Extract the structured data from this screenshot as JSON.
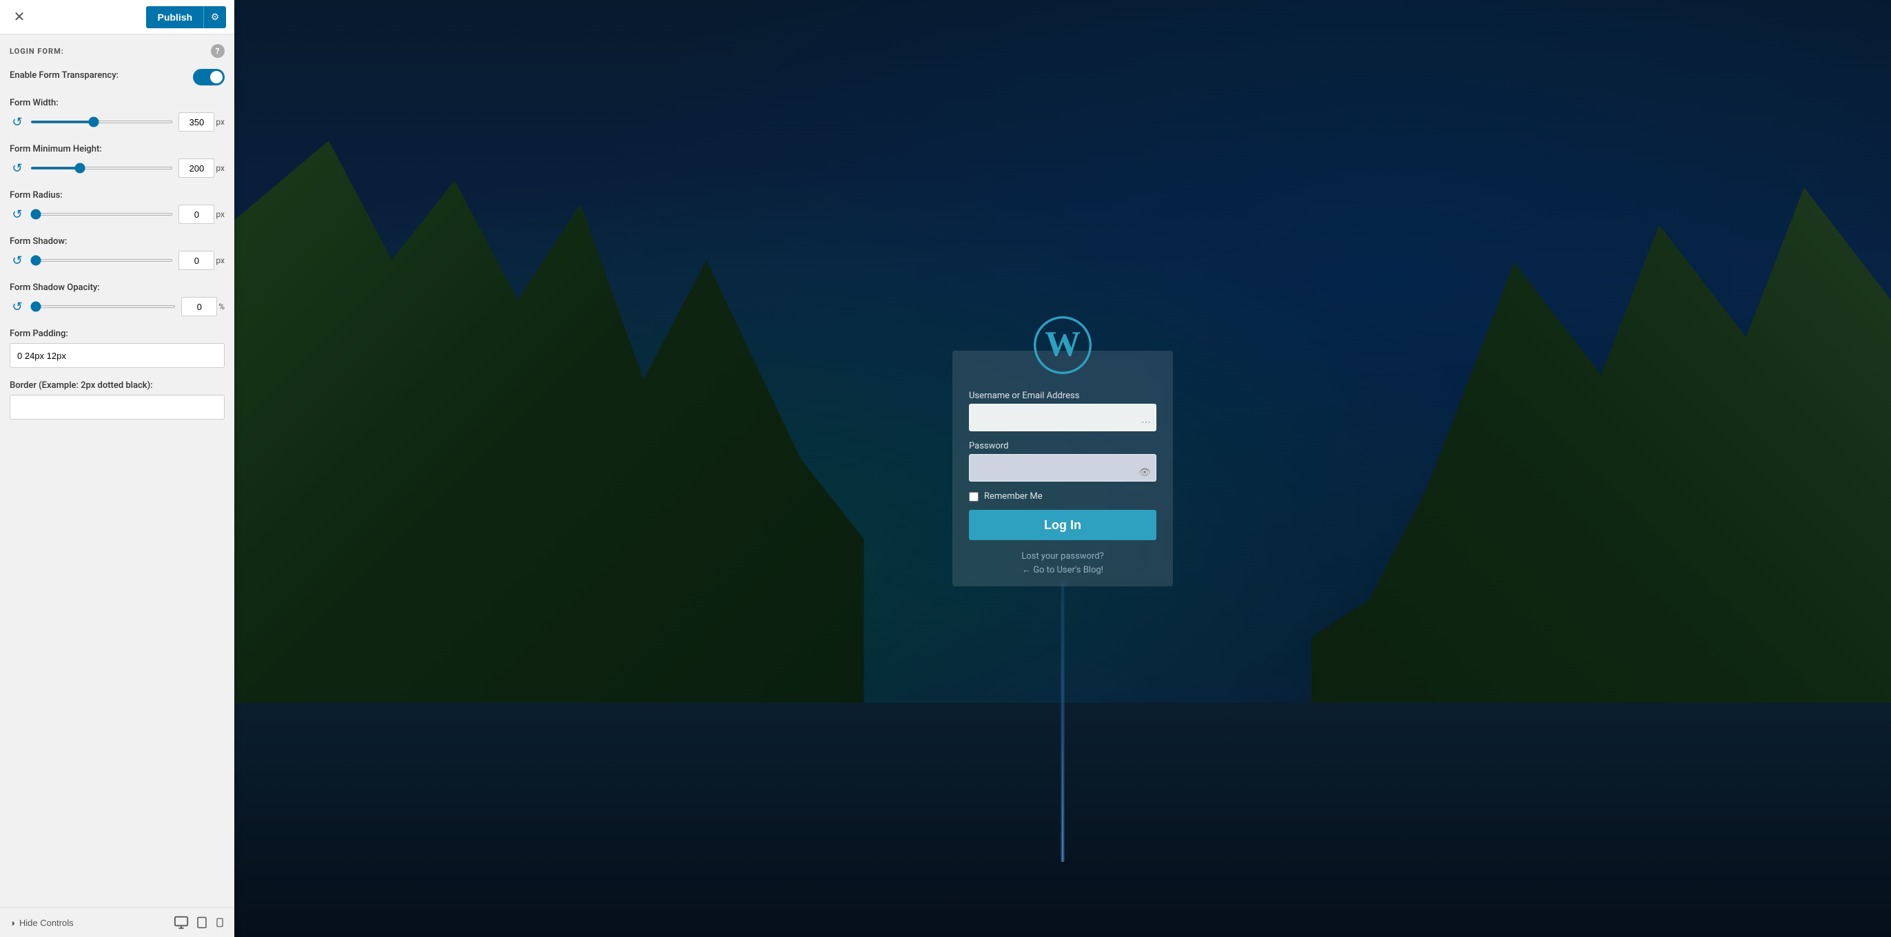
{
  "topbar": {
    "close_label": "✕",
    "publish_label": "Publish",
    "gear_label": "⚙"
  },
  "section": {
    "title": "LOGIN FORM:",
    "help": "?"
  },
  "controls": {
    "transparency": {
      "label": "Enable Form Transparency:",
      "enabled": true
    },
    "form_width": {
      "label": "Form Width:",
      "value": "350",
      "unit": "px",
      "min": 0,
      "max": 800,
      "current": 350
    },
    "form_min_height": {
      "label": "Form Minimum Height:",
      "value": "200",
      "unit": "px",
      "min": 0,
      "max": 600,
      "current": 200
    },
    "form_radius": {
      "label": "Form Radius:",
      "value": "0",
      "unit": "px",
      "min": 0,
      "max": 100,
      "current": 0
    },
    "form_shadow": {
      "label": "Form Shadow:",
      "value": "0",
      "unit": "px",
      "min": 0,
      "max": 100,
      "current": 0
    },
    "form_shadow_opacity": {
      "label": "Form Shadow Opacity:",
      "value": "0",
      "unit": "%",
      "min": 0,
      "max": 100,
      "current": 0
    },
    "form_padding": {
      "label": "Form Padding:",
      "value": "0 24px 12px"
    },
    "border": {
      "label": "Border (Example: 2px dotted black):",
      "placeholder": ""
    }
  },
  "bottom": {
    "hide_controls_label": "Hide Controls",
    "eye_icon": "👁",
    "desktop_icon": "🖥",
    "tablet_icon": "📱",
    "mobile_icon": "📲"
  },
  "login_form": {
    "username_label": "Username or Email Address",
    "password_label": "Password",
    "remember_label": "Remember Me",
    "login_button": "Log In",
    "lost_password": "Lost your password?",
    "go_to_blog": "← Go to User's Blog!"
  }
}
